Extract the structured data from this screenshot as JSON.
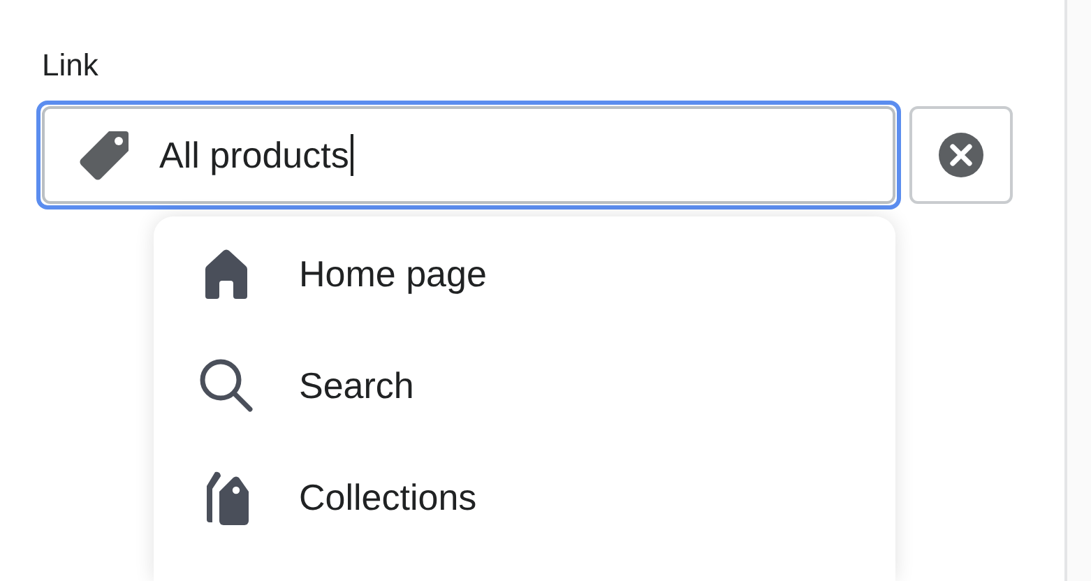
{
  "field": {
    "label": "Link",
    "value": "All products",
    "focused": true
  },
  "menu": {
    "items": [
      {
        "label": "Home page",
        "kind": "home"
      },
      {
        "label": "Search",
        "kind": "search"
      },
      {
        "label": "Collections",
        "kind": "collections"
      }
    ]
  }
}
